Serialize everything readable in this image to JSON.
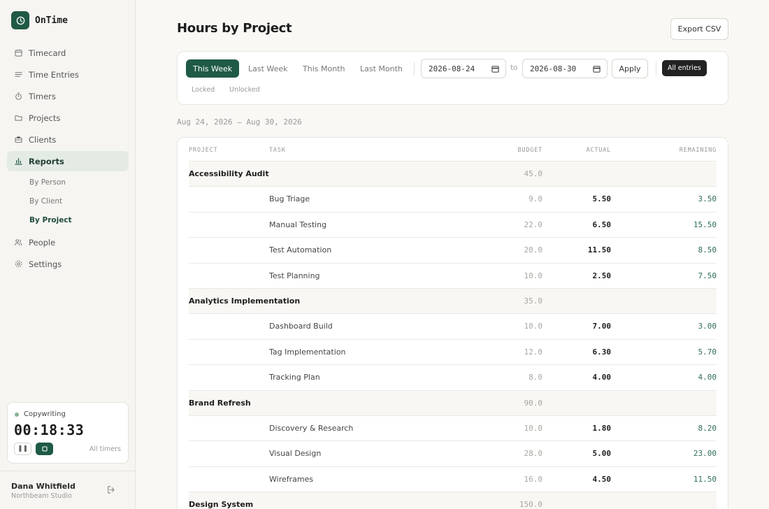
{
  "app": {
    "name": "OnTime"
  },
  "sidebar": {
    "items": [
      {
        "label": "Timecard",
        "icon": "calendar-icon"
      },
      {
        "label": "Time Entries",
        "icon": "list-icon"
      },
      {
        "label": "Timers",
        "icon": "stopwatch-icon"
      },
      {
        "label": "Projects",
        "icon": "folder-icon"
      },
      {
        "label": "Clients",
        "icon": "briefcase-icon"
      },
      {
        "label": "Reports",
        "icon": "bar-chart-icon"
      },
      {
        "label": "People",
        "icon": "people-icon"
      },
      {
        "label": "Settings",
        "icon": "gear-icon"
      }
    ],
    "report_sub": [
      "By Person",
      "By Client",
      "By Project"
    ],
    "active_item": "Reports",
    "active_sub": "By Project"
  },
  "timer": {
    "task": "Copywriting",
    "time": "00:18:33",
    "all_timers": "All timers"
  },
  "user": {
    "name": "Dana Whitfield",
    "org": "Northbeam Studio"
  },
  "header": {
    "title": "Hours by Project",
    "export_label": "Export CSV"
  },
  "filters": {
    "periods": [
      "This Week",
      "Last Week",
      "This Month",
      "Last Month"
    ],
    "active_period": "This Week",
    "date_from": "2026-08-24",
    "to_label": "to",
    "date_to": "2026-08-30",
    "apply_label": "Apply",
    "lock_chips": [
      "All entries",
      "Locked",
      "Unlocked"
    ],
    "active_lock": "All entries"
  },
  "range_label": "Aug 24, 2026 — Aug 30, 2026",
  "table": {
    "headers": {
      "project": "PROJECT",
      "task": "TASK",
      "budget": "BUDGET",
      "actual": "ACTUAL",
      "remaining": "REMAINING"
    },
    "rows": [
      {
        "type": "project",
        "project": "Accessibility Audit",
        "task": "",
        "budget": "45.0",
        "actual": "",
        "remaining": ""
      },
      {
        "type": "task",
        "project": "",
        "task": "Bug Triage",
        "budget": "9.0",
        "actual": "5.50",
        "remaining": "3.50"
      },
      {
        "type": "task",
        "project": "",
        "task": "Manual Testing",
        "budget": "22.0",
        "actual": "6.50",
        "remaining": "15.50"
      },
      {
        "type": "task",
        "project": "",
        "task": "Test Automation",
        "budget": "20.0",
        "actual": "11.50",
        "remaining": "8.50"
      },
      {
        "type": "task",
        "project": "",
        "task": "Test Planning",
        "budget": "10.0",
        "actual": "2.50",
        "remaining": "7.50"
      },
      {
        "type": "project",
        "project": "Analytics Implementation",
        "task": "",
        "budget": "35.0",
        "actual": "",
        "remaining": ""
      },
      {
        "type": "task",
        "project": "",
        "task": "Dashboard Build",
        "budget": "10.0",
        "actual": "7.00",
        "remaining": "3.00"
      },
      {
        "type": "task",
        "project": "",
        "task": "Tag Implementation",
        "budget": "12.0",
        "actual": "6.30",
        "remaining": "5.70"
      },
      {
        "type": "task",
        "project": "",
        "task": "Tracking Plan",
        "budget": "8.0",
        "actual": "4.00",
        "remaining": "4.00"
      },
      {
        "type": "project",
        "project": "Brand Refresh",
        "task": "",
        "budget": "90.0",
        "actual": "",
        "remaining": ""
      },
      {
        "type": "task",
        "project": "",
        "task": "Discovery & Research",
        "budget": "10.0",
        "actual": "1.80",
        "remaining": "8.20"
      },
      {
        "type": "task",
        "project": "",
        "task": "Visual Design",
        "budget": "28.0",
        "actual": "5.00",
        "remaining": "23.00"
      },
      {
        "type": "task",
        "project": "",
        "task": "Wireframes",
        "budget": "16.0",
        "actual": "4.50",
        "remaining": "11.50"
      },
      {
        "type": "project",
        "project": "Design System",
        "task": "",
        "budget": "150.0",
        "actual": "",
        "remaining": ""
      }
    ]
  },
  "colors": {
    "accent": "#1f5a46",
    "remaining": "#2f6e56",
    "background": "#f9f8f5"
  }
}
